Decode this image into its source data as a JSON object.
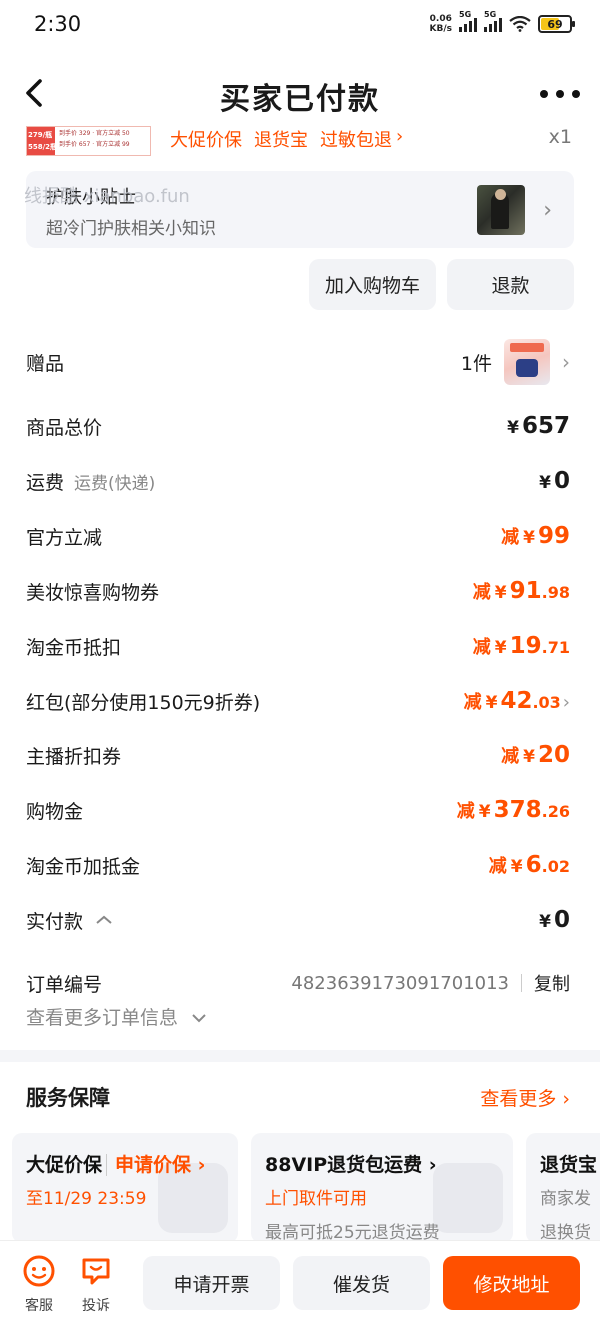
{
  "status_bar": {
    "time": "2:30",
    "net_speed_value": "0.06",
    "net_speed_unit": "KB/s",
    "sim1_label": "5G",
    "sim2_label": "5G",
    "battery": "69"
  },
  "header": {
    "title": "买家已付款"
  },
  "product": {
    "promo_badge_line1": "279/瓶",
    "promo_badge_line2": "558/2瓶",
    "promo_line1": "到手价 329 · 官方立减 50",
    "promo_line2": "到手价 657 · 官方立减 99",
    "tags": [
      "大促价保",
      "退货宝",
      "过敏包退"
    ],
    "quantity": "x1"
  },
  "tips": {
    "title": "护肤小贴士",
    "subtitle": "超冷门护肤相关小知识",
    "watermark": "线报酷 xianbao.fun"
  },
  "actions": {
    "add_cart": "加入购物车",
    "refund": "退款"
  },
  "price_rows": {
    "gift_label": "赠品",
    "gift_count": "1件",
    "total_label": "商品总价",
    "total_value": "657",
    "shipping_label": "运费",
    "shipping_sub": "运费(快递)",
    "shipping_value": "0",
    "official_label": "官方立减",
    "official_value": "99",
    "beauty_label": "美妆惊喜购物券",
    "beauty_int": "91",
    "beauty_dec": ".98",
    "coin_label": "淘金币抵扣",
    "coin_int": "19",
    "coin_dec": ".71",
    "redpack_label": "红包(部分使用150元9折券)",
    "redpack_int": "42",
    "redpack_dec": ".03",
    "anchor_label": "主播折扣券",
    "anchor_value": "20",
    "shopgold_label": "购物金",
    "shopgold_int": "378",
    "shopgold_dec": ".26",
    "coinplus_label": "淘金币加抵金",
    "coinplus_int": "6",
    "coinplus_dec": ".02",
    "paid_label": "实付款",
    "paid_value": "0",
    "minus": "减",
    "currency": "¥"
  },
  "order": {
    "number_label": "订单编号",
    "number": "4823639173091701013",
    "copy": "复制",
    "more_info": "查看更多订单信息"
  },
  "service": {
    "title": "服务保障",
    "more": "查看更多",
    "cards": [
      {
        "title": "大促价保",
        "action": "申请价保",
        "line2": "至11/29 23:59",
        "line3": ""
      },
      {
        "title": "88VIP退货包运费",
        "action": "",
        "line2": "上门取件可用",
        "line3": "最高可抵25元退货运费"
      },
      {
        "title": "退货宝",
        "action": "",
        "line2": "商家发",
        "line3": "退换货"
      }
    ]
  },
  "bottom": {
    "service_label": "客服",
    "complain_label": "投诉",
    "invoice": "申请开票",
    "urge": "催发货",
    "modify_address": "修改地址"
  },
  "colors": {
    "accent": "#ff5000",
    "card_bg": "#f4f5f8"
  }
}
